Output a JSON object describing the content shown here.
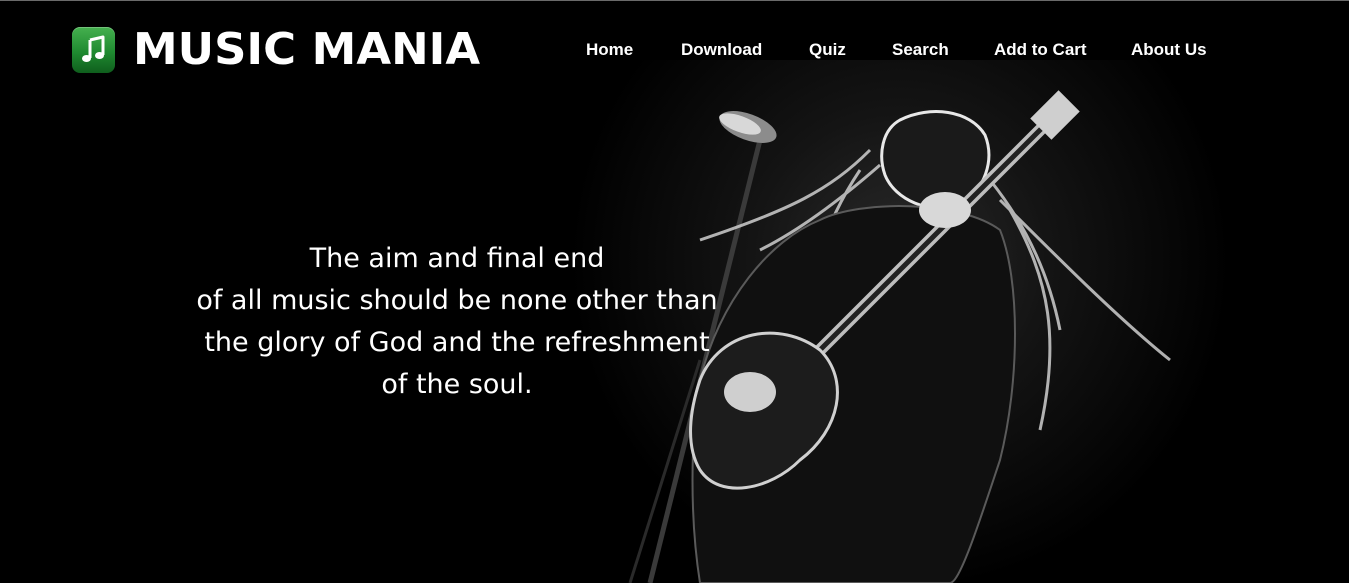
{
  "header": {
    "brand": "MUSIC MANIA",
    "logo_icon": "music-note-icon",
    "logo_color": "#2e9c3b"
  },
  "nav": {
    "items": [
      {
        "label": "Home"
      },
      {
        "label": "Download"
      },
      {
        "label": "Quiz"
      },
      {
        "label": "Search"
      },
      {
        "label": "Add to Cart"
      },
      {
        "label": "About Us"
      }
    ]
  },
  "hero": {
    "image": "guitarist-performing-photo",
    "quote_lines": [
      "The aim and final end",
      "of all music should be none other than",
      "the glory of God and the refreshment",
      "of the soul."
    ]
  }
}
